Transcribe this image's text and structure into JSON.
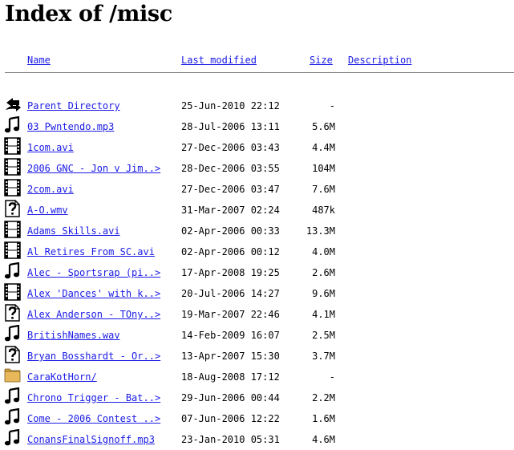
{
  "title": "Index of /misc",
  "columns": {
    "name": "Name",
    "last_modified": "Last modified",
    "size": "Size",
    "description": "Description"
  },
  "entries": [
    {
      "icon": "back-icon",
      "name": "Parent Directory",
      "date": "25-Jun-2010 22:12",
      "size": "-"
    },
    {
      "icon": "sound-icon",
      "name": "03 Pwntendo.mp3",
      "date": "28-Jul-2006 13:11",
      "size": "5.6M"
    },
    {
      "icon": "movie-icon",
      "name": "1com.avi",
      "date": "27-Dec-2006 03:43",
      "size": "4.4M"
    },
    {
      "icon": "movie-icon",
      "name": "2006 GNC - Jon v Jim..>",
      "date": "28-Dec-2006 03:55",
      "size": "104M"
    },
    {
      "icon": "movie-icon",
      "name": "2com.avi",
      "date": "27-Dec-2006 03:47",
      "size": "7.6M"
    },
    {
      "icon": "unknown-icon",
      "name": "A-O.wmv",
      "date": "31-Mar-2007 02:24",
      "size": "487k"
    },
    {
      "icon": "movie-icon",
      "name": "Adams Skills.avi",
      "date": "02-Apr-2006 00:33",
      "size": "13.3M"
    },
    {
      "icon": "movie-icon",
      "name": "Al Retires From SC.avi",
      "date": "02-Apr-2006 00:12",
      "size": "4.0M"
    },
    {
      "icon": "sound-icon",
      "name": "Alec - Sportsrap (pi..>",
      "date": "17-Apr-2008 19:25",
      "size": "2.6M"
    },
    {
      "icon": "movie-icon",
      "name": "Alex 'Dances' with k..>",
      "date": "20-Jul-2006 14:27",
      "size": "9.6M"
    },
    {
      "icon": "unknown-icon",
      "name": "Alex Anderson - TOny..>",
      "date": "19-Mar-2007 22:46",
      "size": "4.1M"
    },
    {
      "icon": "sound-icon",
      "name": "BritishNames.wav",
      "date": "14-Feb-2009 16:07",
      "size": "2.5M"
    },
    {
      "icon": "unknown-icon",
      "name": "Bryan Bosshardt - Or..>",
      "date": "13-Apr-2007 15:30",
      "size": "3.7M"
    },
    {
      "icon": "folder-icon",
      "name": "CaraKotHorn/",
      "date": "18-Aug-2008 17:12",
      "size": "-"
    },
    {
      "icon": "sound-icon",
      "name": "Chrono Trigger - Bat..>",
      "date": "29-Jun-2006 00:44",
      "size": "2.2M"
    },
    {
      "icon": "sound-icon",
      "name": "Come - 2006 Contest ..>",
      "date": "07-Jun-2006 12:22",
      "size": "1.6M"
    },
    {
      "icon": "sound-icon",
      "name": "ConansFinalSignoff.mp3",
      "date": "23-Jan-2010 05:31",
      "size": "4.6M"
    }
  ]
}
